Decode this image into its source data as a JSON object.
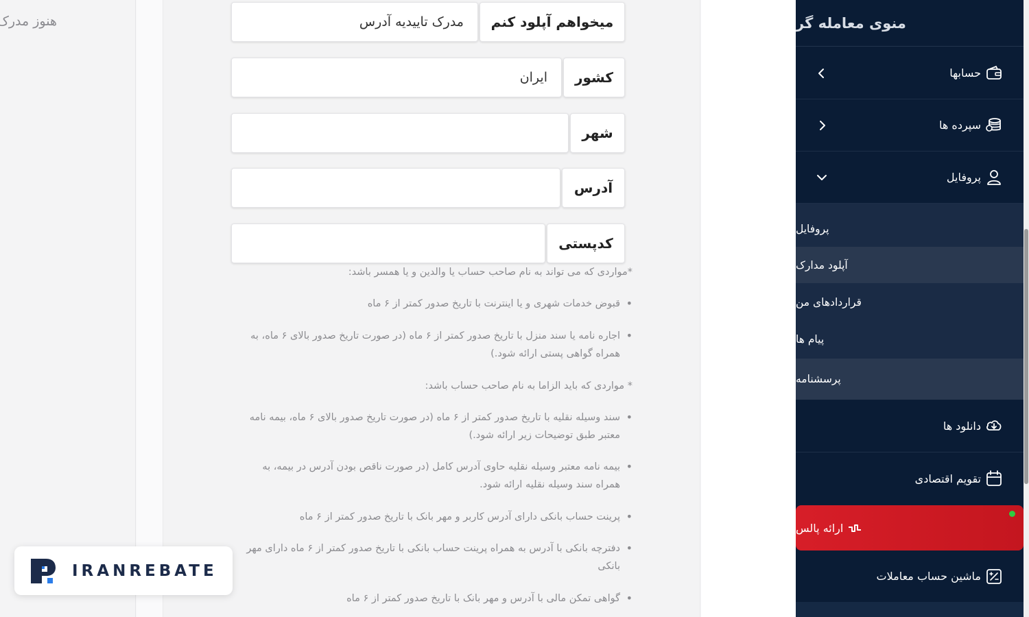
{
  "left_panel": {
    "cut_text": "هنوز مدرک"
  },
  "form": {
    "upload_label": "میخواهم آپلود کنم",
    "upload_value": "مدرک تاییدیه آدرس",
    "country_label": "کشور",
    "country_value": "ایران",
    "city_label": "شهر",
    "city_value": "",
    "address_label": "آدرس",
    "address_value": "",
    "postal_label": "کدپستی",
    "postal_value": ""
  },
  "notes": {
    "heading1": "*مواردی که می تواند به نام صاحب حساب یا والدین و یا همسر باشد:",
    "list1": [
      "قبوض خدمات شهری و یا اینترنت با تاریخ صدور کمتر از ۶ ماه",
      "اجاره نامه یا سند منزل با تاریخ صدور کمتر از ۶ ماه (در صورت تاریخ صدور بالای ۶ ماه، به همراه گواهی پستی ارائه شود.)"
    ],
    "heading2": "* مواردی که باید الزاما به نام صاحب حساب باشد:",
    "list2": [
      "سند وسیله نقلیه با تاریخ صدور کمتر از ۶ ماه (در صورت تاریخ صدور بالای ۶ ماه، بیمه نامه معتبر طبق توضیحات زیر ارائه شود.)",
      "بیمه نامه معتبر وسیله نقلیه حاوی آدرس کامل (در صورت ناقص بودن آدرس در بیمه، به همراه سند وسیله نقلیه ارائه شود.",
      "پرینت حساب بانکی دارای آدرس کاربر و مهر بانک با تاریخ صدور کمتر از ۶ ماه",
      "دفترچه بانکی با آدرس به همراه پرینت حساب بانکی با تاریخ صدور کمتر از ۶ ماه دارای مهر بانکی",
      "گواهی تمکن مالی با آدرس و مهر بانک با تاریخ صدور کمتر از ۶ ماه"
    ]
  },
  "sidebar": {
    "title": "منوی معامله گر",
    "accounts": "حسابها",
    "deposits": "سپرده ها",
    "profile": "پروفایل",
    "sub": {
      "profile": "پروفایل",
      "upload_docs": "آپلود مدارک",
      "contracts": "قراردادهای من",
      "messages": "پیام ها",
      "questionnaire": "پرسشنامه"
    },
    "downloads": "دانلود ها",
    "calendar": "تقویم اقتصادی",
    "pulse": "ارائه پالس",
    "calculator": "ماشین حساب معاملات",
    "colors": {
      "bg": "#0a1c35",
      "active_red": "#d71e28"
    }
  },
  "logo": {
    "text": "IRANREBATE"
  }
}
